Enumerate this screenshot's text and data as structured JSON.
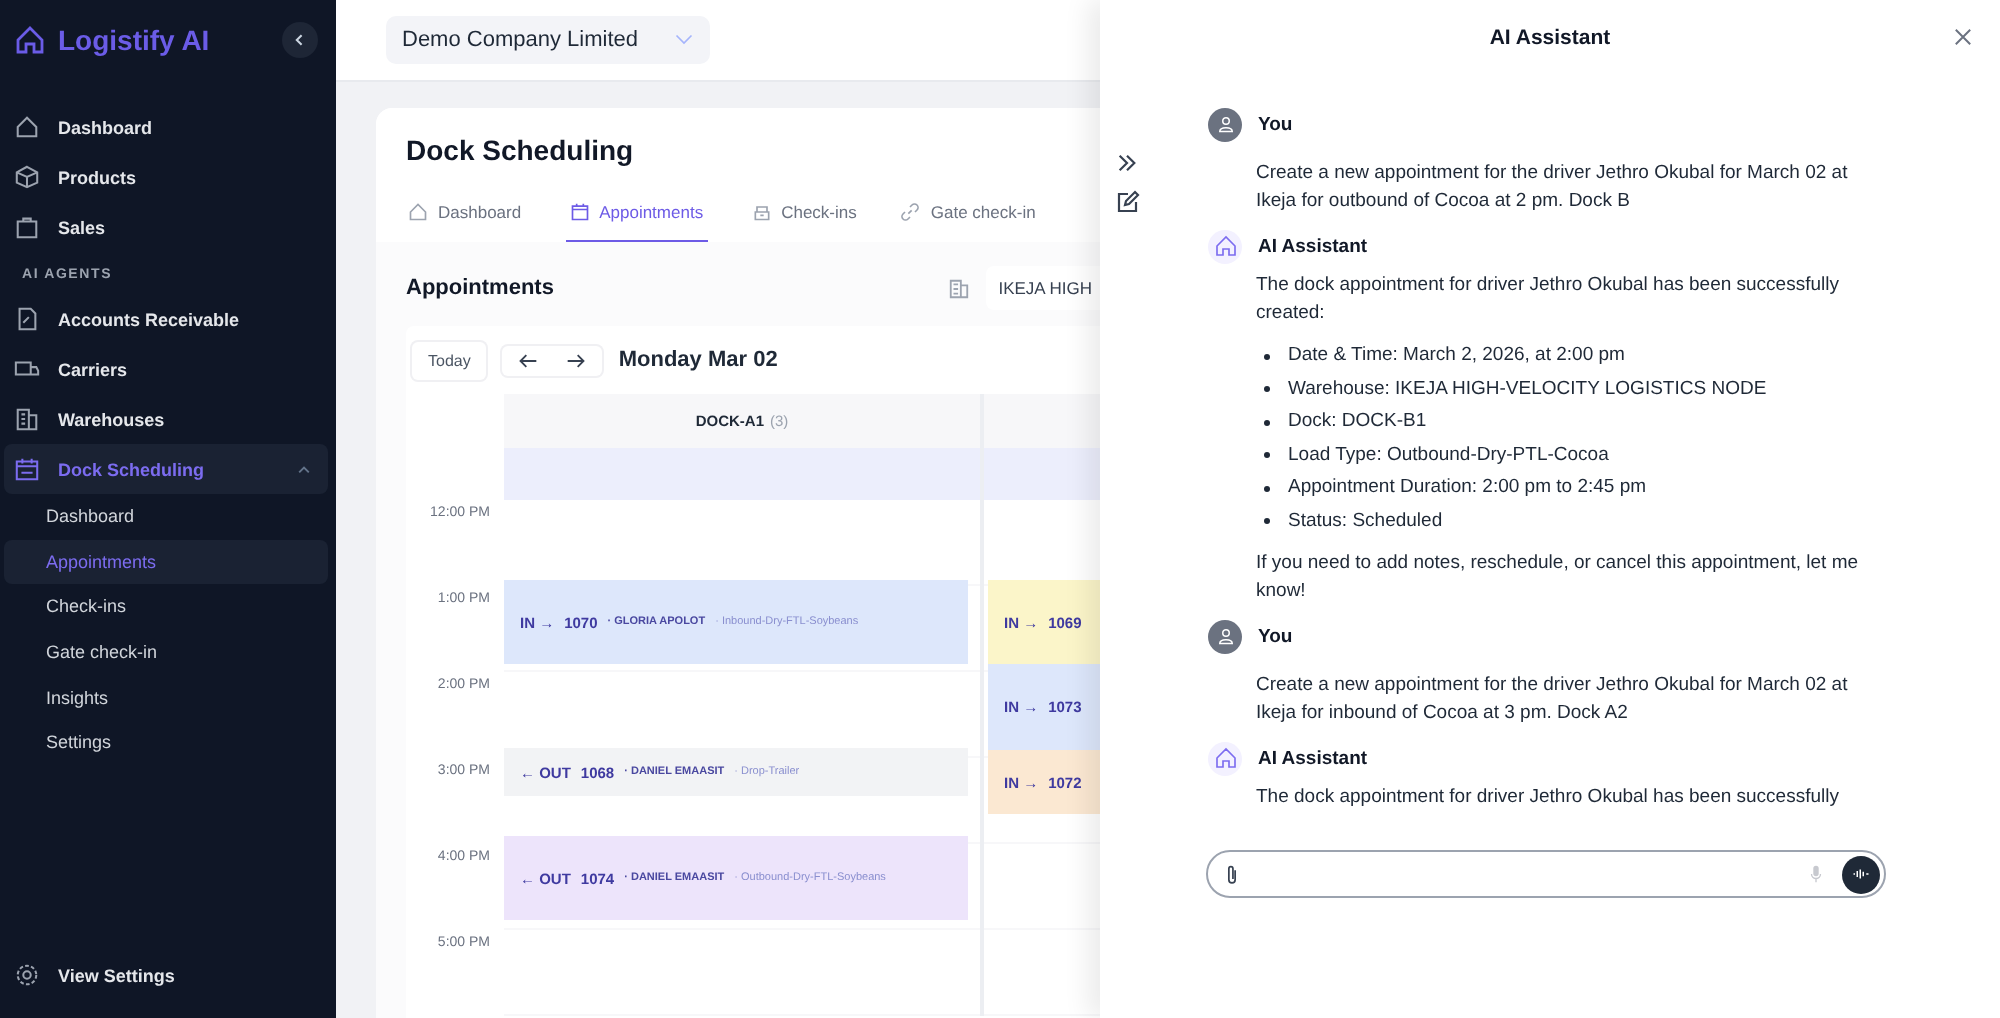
{
  "sidebar": {
    "brand": "Logistify AI",
    "main_items": [
      {
        "label": "Dashboard",
        "selected": false
      },
      {
        "label": "Products",
        "selected": false
      },
      {
        "label": "Sales",
        "selected": false
      }
    ],
    "section_label": "AI AGENTS",
    "agent_items": [
      {
        "label": "Accounts Receivable",
        "selected": false
      },
      {
        "label": "Carriers",
        "selected": false
      },
      {
        "label": "Warehouses",
        "selected": false
      },
      {
        "label": "Dock Scheduling",
        "selected": true,
        "expanded": true,
        "children": [
          {
            "label": "Dashboard",
            "selected": false
          },
          {
            "label": "Appointments",
            "selected": true
          },
          {
            "label": "Check-ins",
            "selected": false
          },
          {
            "label": "Gate check-in",
            "selected": false
          },
          {
            "label": "Insights",
            "selected": false
          },
          {
            "label": "Settings",
            "selected": false
          }
        ]
      }
    ],
    "footer_item": "View Settings"
  },
  "header": {
    "company": "Demo Company Limited"
  },
  "page": {
    "title": "Dock Scheduling",
    "tabs": [
      {
        "label": "Dashboard",
        "selected": false
      },
      {
        "label": "Appointments",
        "selected": true
      },
      {
        "label": "Check-ins",
        "selected": false
      },
      {
        "label": "Gate check-in",
        "selected": false
      }
    ],
    "section_title": "Appointments",
    "warehouse": "IKEJA HIGH",
    "today_button": "Today",
    "date": "Monday Mar 02",
    "hours": [
      "12:00 PM",
      "1:00 PM",
      "2:00 PM",
      "3:00 PM",
      "4:00 PM",
      "5:00 PM"
    ],
    "docks": [
      {
        "name": "DOCK-A1",
        "count": "(3)",
        "appointments": [
          {
            "direction": "IN →",
            "number": "1070",
            "driver": "· GLORIA APOLOT",
            "load": "· Inbound-Dry-FTL-Soybeans",
            "color": "#dde7fb"
          },
          {
            "direction": "← OUT",
            "number": "1068",
            "driver": "· DANIEL EMAASIT",
            "load": "· Drop-Trailer",
            "color": "#f2f3f5"
          },
          {
            "direction": "← OUT",
            "number": "1074",
            "driver": "· DANIEL EMAASIT",
            "load": "· Outbound-Dry-FTL-Soybeans",
            "color": "#ede4fb"
          }
        ]
      },
      {
        "appointments": [
          {
            "direction": "IN →",
            "number": "1069",
            "color": "#fbf5c9"
          },
          {
            "direction": "IN →",
            "number": "1073",
            "color": "#dde7fb"
          },
          {
            "direction": "IN →",
            "number": "1072",
            "color": "#fbe8d2"
          }
        ]
      }
    ]
  },
  "assistant": {
    "title": "AI Assistant",
    "messages": [
      {
        "kind": "user",
        "author": "You",
        "blocks": [
          {
            "kind": "text",
            "text": "Create a new appointment for the driver Jethro Okubal for March 02 at Ikeja for outbound of Cocoa at 2 pm. Dock B"
          }
        ]
      },
      {
        "kind": "assistant",
        "author": "AI Assistant",
        "blocks": [
          {
            "kind": "text",
            "text": "The dock appointment for driver Jethro Okubal has been successfully created:"
          },
          {
            "kind": "list",
            "items": [
              "Date & Time: March 2, 2026, at 2:00 pm",
              "Warehouse: IKEJA HIGH-VELOCITY LOGISTICS NODE",
              "Dock: DOCK-B1",
              "Load Type: Outbound-Dry-PTL-Cocoa",
              "Appointment Duration: 2:00 pm to 2:45 pm",
              "Status: Scheduled"
            ]
          },
          {
            "kind": "text",
            "text": "If you need to add notes, reschedule, or cancel this appointment, let me know!"
          }
        ]
      },
      {
        "kind": "user",
        "author": "You",
        "blocks": [
          {
            "kind": "text",
            "text": "Create a new appointment for the driver Jethro Okubal for March 02 at Ikeja for inbound of Cocoa at 3 pm. Dock A2"
          }
        ]
      },
      {
        "kind": "assistant",
        "author": "AI Assistant",
        "blocks": [
          {
            "kind": "text",
            "text": "The dock appointment for driver Jethro Okubal has been successfully"
          }
        ]
      }
    ]
  }
}
